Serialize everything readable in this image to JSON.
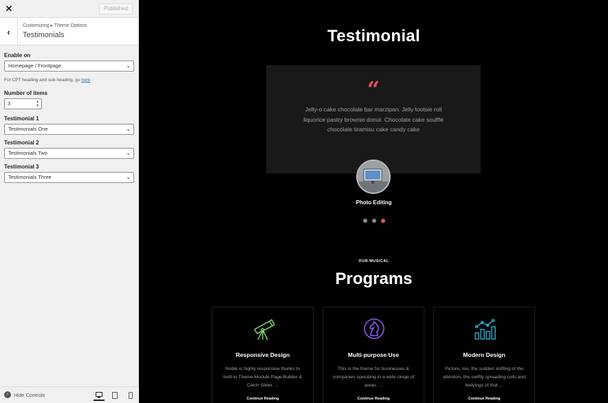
{
  "customizer": {
    "published_label": "Published",
    "breadcrumb": "Customizing ▸ Theme Options",
    "section_title": "Testimonials",
    "enable_on": {
      "label": "Enable on",
      "value": "Homepage / Frontpage"
    },
    "cpt_note": {
      "text": "For CPT heading and sub-heading, go ",
      "link": "here"
    },
    "number_of_items": {
      "label": "Number of items",
      "value": "3"
    },
    "testimonials": [
      {
        "label": "Testimonial 1",
        "value": "Testimonials One"
      },
      {
        "label": "Testimonial 2",
        "value": "Testimonials Two"
      },
      {
        "label": "Testimonial 3",
        "value": "Testimonials Three"
      }
    ],
    "footer": {
      "hide_controls": "Hide Controls"
    }
  },
  "preview": {
    "testimonial": {
      "title": "Testimonial",
      "quote_mark": "“",
      "text": "Jelly-o cake chocolate bar marzipan. Jelly tootsie roll liquorice pastry brownie donut. Chocolate cake soufflé chocolate tiramisu cake candy cake",
      "name": "Photo Editing",
      "dots": 3,
      "active_dot": 3
    },
    "programs": {
      "subtitle": "OUR MUSICAL",
      "title": "Programs",
      "cards": [
        {
          "icon": "telescope-icon",
          "title": "Responsive Design",
          "text": "Noble is highly responsive thanks to built-in Theme Module Page Builder & Catch Slider. ...",
          "link": "Continue Reading",
          "color": "#7fd36b"
        },
        {
          "icon": "chess-knight-icon",
          "title": "Multi-purpose Use",
          "text": "This is the theme for businesses & companies operating in a wide range of areas. ...",
          "link": "Continue Reading",
          "color": "#8b5cf6"
        },
        {
          "icon": "bar-chart-icon",
          "title": "Modern Design",
          "text": "Picture, too, the sudden shifting of the attention, the swiftly spreading coils and bellyings of that ...",
          "link": "Continue Reading",
          "color": "#2ba6c4"
        }
      ]
    }
  },
  "colors": {
    "accent": "#e8505b",
    "link": "#2271b1"
  }
}
